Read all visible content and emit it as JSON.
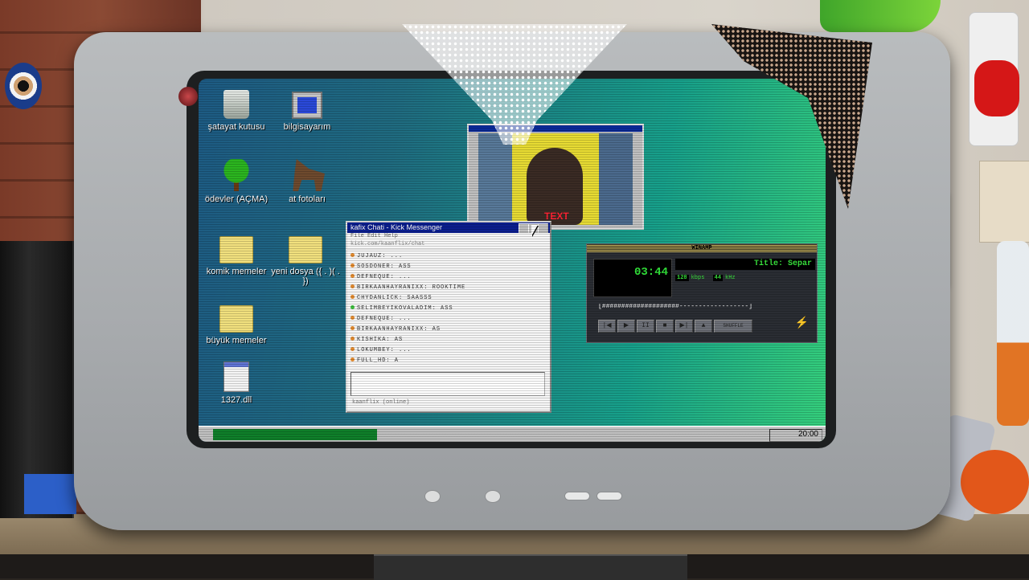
{
  "desktop": {
    "icons": [
      {
        "label": "şatayat kutusu"
      },
      {
        "label": "bilgisayarım"
      },
      {
        "label": "ödevler (AÇMA)"
      },
      {
        "label": "at fotoları"
      },
      {
        "label": "komik memeler"
      },
      {
        "label": "yeni dosya ({ . )( . })"
      },
      {
        "label": "büyük memeler"
      },
      {
        "label": "1327.dll"
      }
    ]
  },
  "video_window": {
    "caption": "TEXT"
  },
  "chat_window": {
    "title": "kafix Chati - Kick Messenger",
    "menu": "File  Edit  Help",
    "url": "kick.com/kaanflix/chat",
    "messages": [
      {
        "text": "JUJAUZ: ..."
      },
      {
        "text": "SOSDONER: ASS"
      },
      {
        "text": "DEFNEQUE: ..."
      },
      {
        "text": "BIRKAANHAYRANIXX: ROOKTIME"
      },
      {
        "text": "CHYDANLICK: SAASSS"
      },
      {
        "text": "SELIMBEYIKOVALADIM: ASS"
      },
      {
        "text": "DEFNEQUE: ..."
      },
      {
        "text": "BIRKAANHAYRANIXX: AS"
      },
      {
        "text": "KISHIKA: AS"
      },
      {
        "text": "LOKUMBEY: ..."
      },
      {
        "text": "FULL_HD: A"
      }
    ],
    "status": "kaanflix (online)"
  },
  "winamp": {
    "title_bar": "WINAMP",
    "time": "03:44",
    "track_title": "Title: Separ",
    "kbps": "128",
    "kbps_label": "kbps",
    "khz": "44",
    "khz_label": "kHz",
    "seek_bar": "[####################------------------]",
    "controls": [
      "|◀",
      "▶",
      "II",
      "■",
      "▶|",
      "▲"
    ],
    "shuffle": "SHUFFLE"
  },
  "taskbar": {
    "clock": "20:00"
  }
}
